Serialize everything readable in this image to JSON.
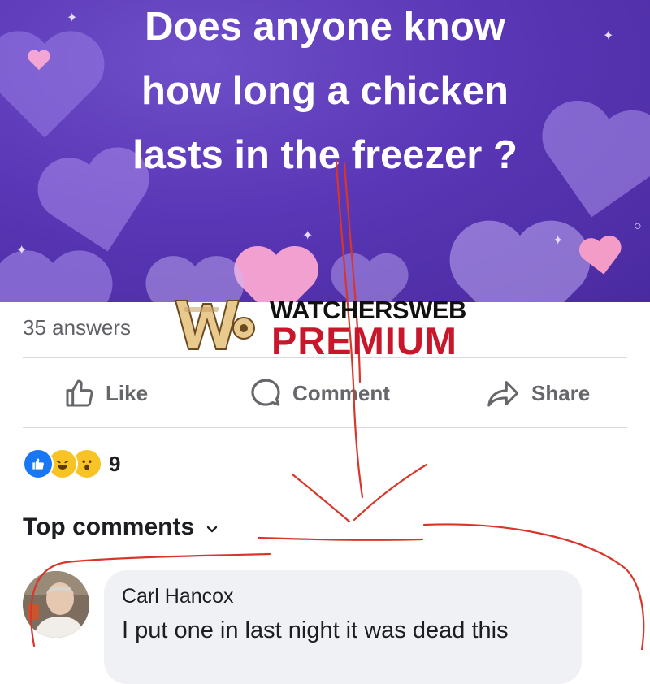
{
  "post": {
    "question_lines": [
      "Does anyone know",
      "how long a chicken",
      "lasts in the freezer ?"
    ]
  },
  "stats": {
    "answers_label": "35 answers"
  },
  "actions": {
    "like": "Like",
    "comment": "Comment",
    "share": "Share"
  },
  "reactions": {
    "icons": [
      "like-reaction",
      "haha-reaction",
      "wow-reaction"
    ],
    "count": "9"
  },
  "comments_section": {
    "sort_label": "Top comments",
    "items": [
      {
        "author": "Carl Hancox",
        "text": "I put one in last night it was dead this"
      }
    ]
  },
  "watermark": {
    "title": "WATCHERSWEB",
    "subtitle": "PREMIUM"
  },
  "colors": {
    "banner": "#5a37b6",
    "heart": "#b89af0",
    "pink_heart": "#f2a0cf",
    "ink": "#d9362b",
    "watermark_red": "#c8162a"
  }
}
